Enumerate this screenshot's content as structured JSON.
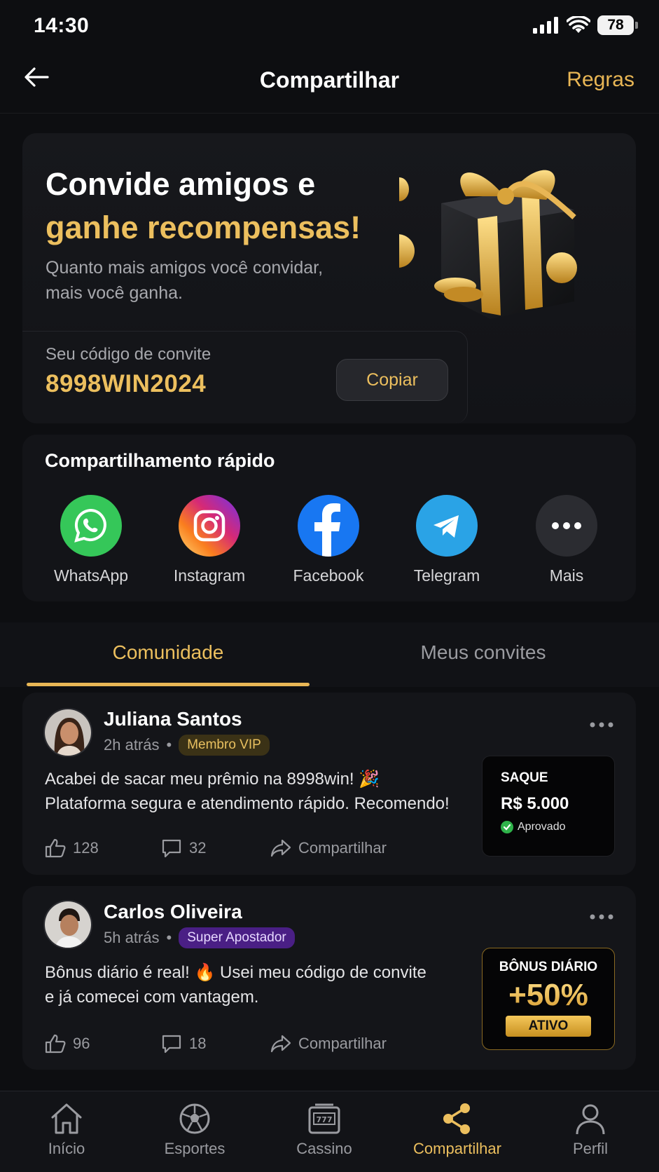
{
  "status_bar": {
    "time": "14:30",
    "battery": "78"
  },
  "header": {
    "title": "Compartilhar",
    "rules_label": "Regras"
  },
  "hero": {
    "headline_line1": "Convide amigos e",
    "headline_line2": "ganhe recompensas!",
    "subtitle_line1": "Quanto mais amigos você convidar,",
    "subtitle_line2": "mais você ganha.",
    "code_label": "Seu código de convite",
    "code_value": "8998WIN2024",
    "copy_label": "Copiar"
  },
  "quick_share": {
    "title": "Compartilhamento rápido",
    "items": [
      {
        "label": "WhatsApp",
        "icon": "whatsapp-icon",
        "color": "#35c759"
      },
      {
        "label": "Instagram",
        "icon": "instagram-icon",
        "color": "#d62976"
      },
      {
        "label": "Facebook",
        "icon": "facebook-icon",
        "color": "#1877f2"
      },
      {
        "label": "Telegram",
        "icon": "telegram-icon",
        "color": "#2aa3e6"
      },
      {
        "label": "Mais",
        "icon": "more-icon",
        "color": "#2b2c31"
      }
    ]
  },
  "tabs": [
    {
      "label": "Comunidade",
      "active": true
    },
    {
      "label": "Meus convites",
      "active": false
    }
  ],
  "posts": [
    {
      "author": "Juliana Santos",
      "time": "2h atrás",
      "badge": "Membro VIP",
      "text_line1": "Acabei de sacar meu prêmio na 8998win! 🎉",
      "text_line2": "Plataforma segura e atendimento rápido. Recomendo!",
      "likes": "128",
      "comments": "32",
      "share_label": "Compartilhar",
      "card": {
        "title": "SAQUE",
        "amount": "R$ 5.000",
        "status": "Aprovado"
      }
    },
    {
      "author": "Carlos Oliveira",
      "time": "5h atrás",
      "badge": "Super Apostador",
      "text_line1": "Bônus diário é real! 🔥 Usei meu código de convite",
      "text_line2": "e já comecei com vantagem.",
      "likes": "96",
      "comments": "18",
      "share_label": "Compartilhar",
      "card": {
        "title": "BÔNUS DIÁRIO",
        "value": "+50%",
        "status": "ATIVO"
      }
    }
  ],
  "bottom_nav": [
    {
      "label": "Início",
      "icon": "home-icon"
    },
    {
      "label": "Esportes",
      "icon": "soccer-ball-icon"
    },
    {
      "label": "Cassino",
      "icon": "slot-machine-icon"
    },
    {
      "label": "Compartilhar",
      "icon": "share-icon",
      "active": true
    },
    {
      "label": "Perfil",
      "icon": "user-icon"
    }
  ],
  "colors": {
    "accent": "#ecbf5e",
    "background": "#0d0e11",
    "card": "#141519"
  }
}
